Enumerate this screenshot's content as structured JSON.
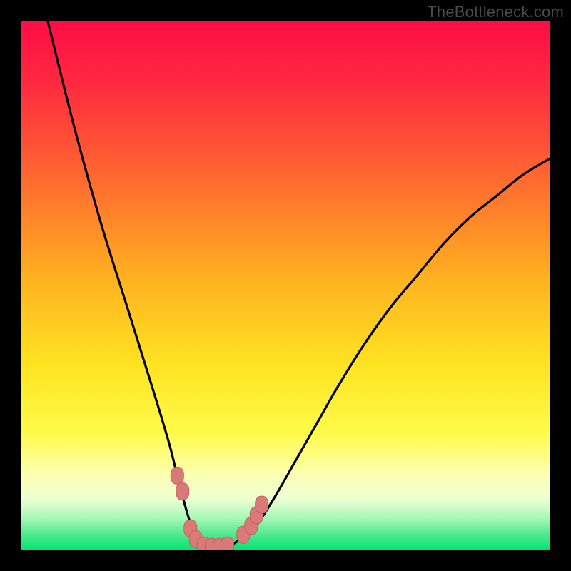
{
  "watermark": "TheBottleneck.com",
  "colors": {
    "frame": "#000000",
    "gradient_stops": [
      {
        "offset": 0.0,
        "color": "#ff0d46"
      },
      {
        "offset": 0.12,
        "color": "#ff2a3f"
      },
      {
        "offset": 0.3,
        "color": "#ff6a2f"
      },
      {
        "offset": 0.5,
        "color": "#ffb61f"
      },
      {
        "offset": 0.65,
        "color": "#ffe321"
      },
      {
        "offset": 0.78,
        "color": "#fffb4a"
      },
      {
        "offset": 0.86,
        "color": "#fcffb5"
      },
      {
        "offset": 0.905,
        "color": "#ecffd2"
      },
      {
        "offset": 0.94,
        "color": "#a8f8b8"
      },
      {
        "offset": 0.97,
        "color": "#54e98f"
      },
      {
        "offset": 1.0,
        "color": "#00e676"
      }
    ],
    "curve": "#000000",
    "marker_fill": "#d97a79",
    "marker_stroke": "#c46160"
  },
  "chart_data": {
    "type": "line",
    "title": "",
    "xlabel": "",
    "ylabel": "",
    "xlim": [
      0,
      100
    ],
    "ylim": [
      0,
      100
    ],
    "series": [
      {
        "name": "bottleneck-curve",
        "x": [
          5,
          10,
          15,
          20,
          25,
          28,
          30,
          32,
          34,
          36,
          38,
          40,
          44,
          48,
          52,
          56,
          60,
          65,
          70,
          75,
          80,
          85,
          90,
          95,
          100
        ],
        "y": [
          100,
          80,
          62,
          46,
          30,
          20,
          12,
          5,
          1,
          0,
          0,
          1,
          4,
          10,
          17,
          24,
          31,
          39,
          46,
          52,
          58,
          63,
          67,
          71,
          74
        ]
      }
    ],
    "markers": [
      {
        "x": 29.5,
        "y": 14
      },
      {
        "x": 30.5,
        "y": 11
      },
      {
        "x": 32.0,
        "y": 4
      },
      {
        "x": 33.0,
        "y": 2
      },
      {
        "x": 34.5,
        "y": 0.8
      },
      {
        "x": 36.0,
        "y": 0.5
      },
      {
        "x": 37.5,
        "y": 0.5
      },
      {
        "x": 39.0,
        "y": 0.8
      },
      {
        "x": 42.0,
        "y": 2.8
      },
      {
        "x": 43.5,
        "y": 4.5
      },
      {
        "x": 44.5,
        "y": 6.5
      },
      {
        "x": 45.5,
        "y": 8.5
      }
    ]
  }
}
